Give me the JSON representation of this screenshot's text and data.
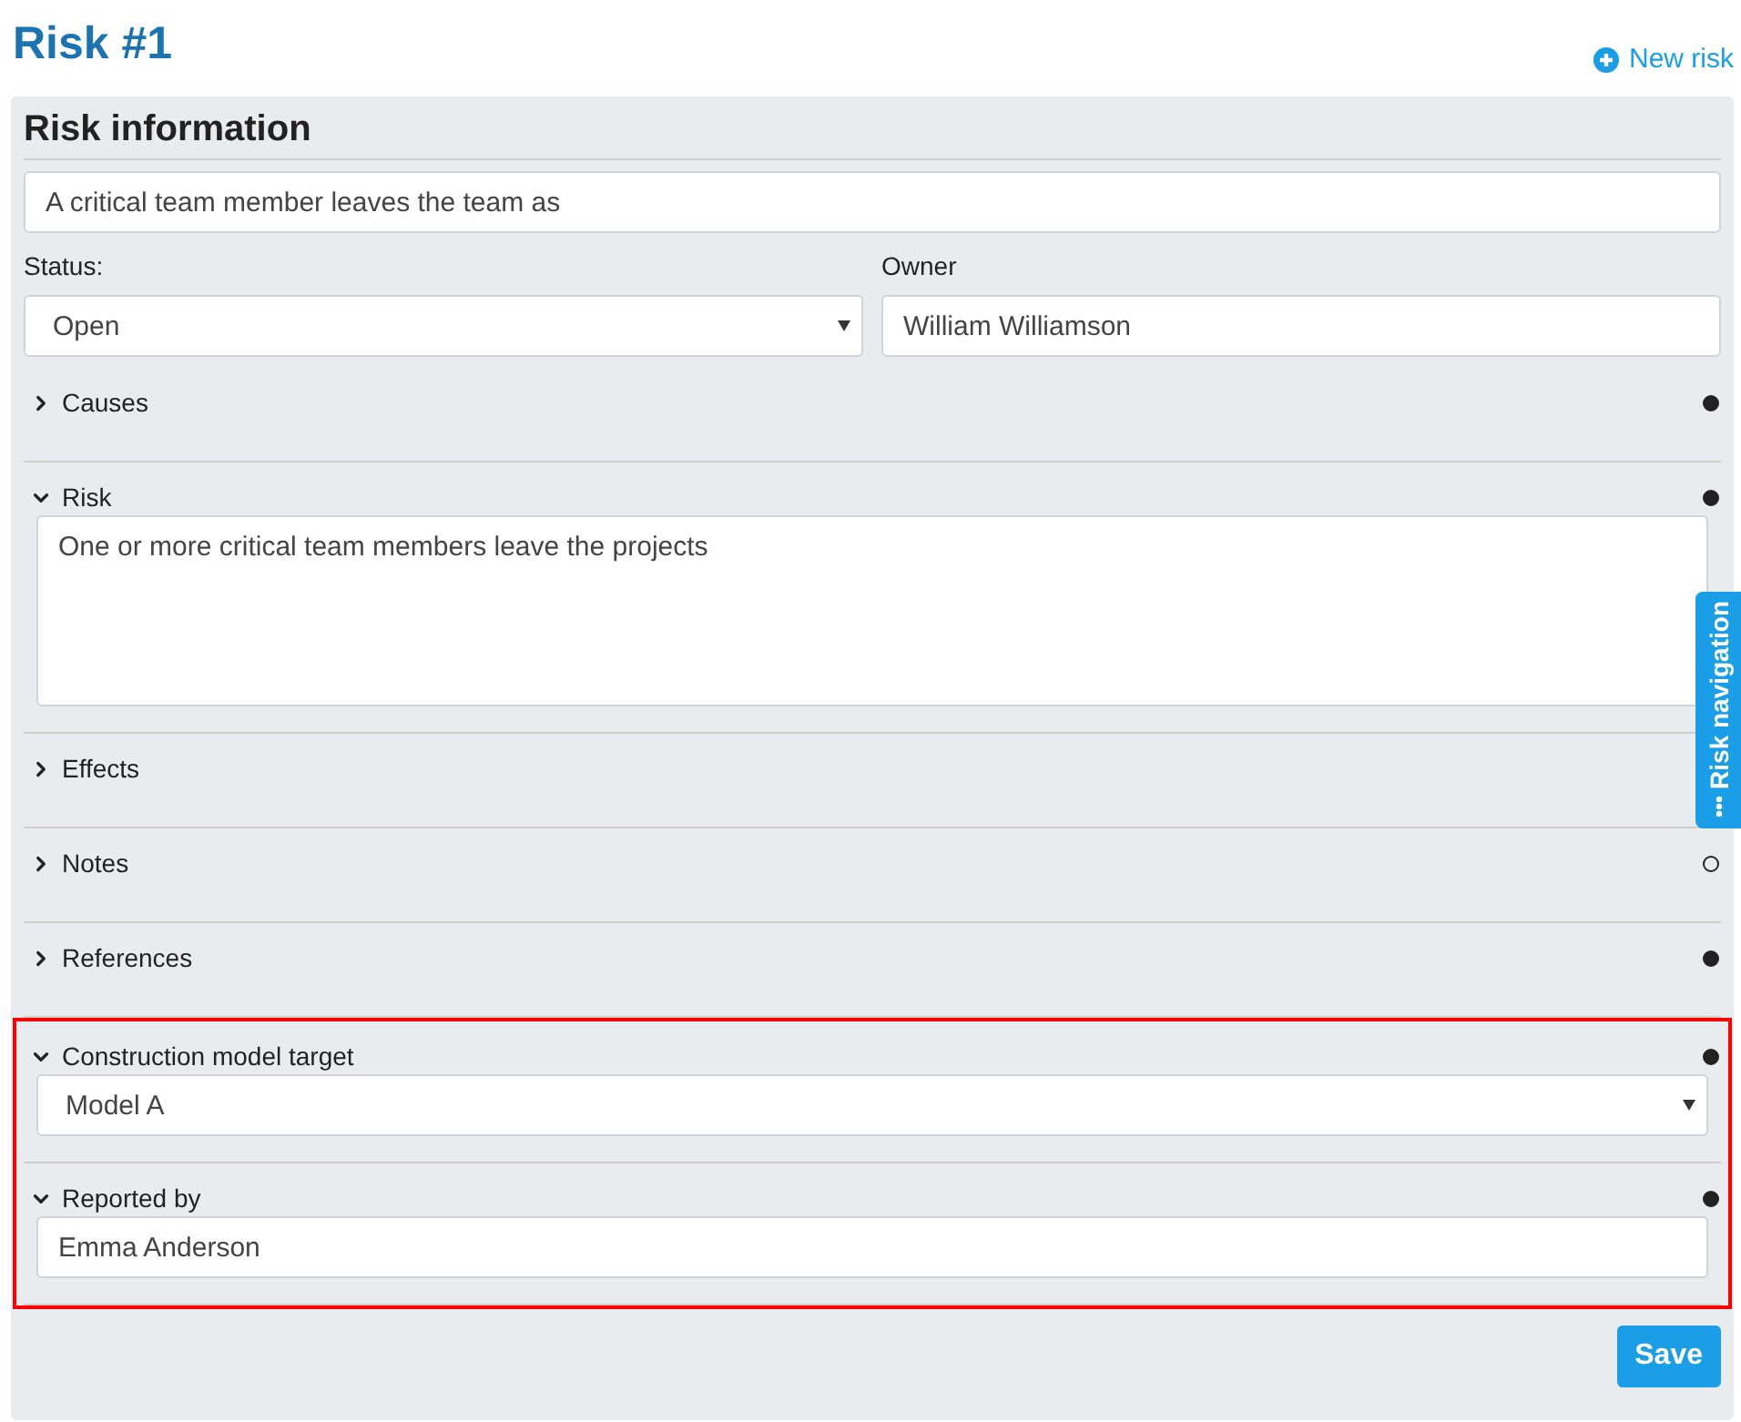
{
  "title": "Risk #1",
  "new_risk_link": "New risk",
  "panel": {
    "heading": "Risk information",
    "name_value": "A critical team member leaves the team as",
    "status": {
      "label": "Status:",
      "value": "Open"
    },
    "owner": {
      "label": "Owner",
      "value": "William Williamson"
    }
  },
  "sections": [
    {
      "label": "Causes",
      "expanded": false,
      "filled": true,
      "highlighted": false
    },
    {
      "label": "Risk",
      "expanded": true,
      "filled": true,
      "highlighted": false,
      "kind": "textarea",
      "value": "One or more critical team members leave the projects"
    },
    {
      "label": "Effects",
      "expanded": false,
      "highlighted": false
    },
    {
      "label": "Notes",
      "expanded": false,
      "filled": false,
      "highlighted": false
    },
    {
      "label": "References",
      "expanded": false,
      "filled": true,
      "highlighted": false
    },
    {
      "label": "Construction model target",
      "expanded": true,
      "filled": true,
      "highlighted": true,
      "kind": "select",
      "value": "Model A"
    },
    {
      "label": "Reported by",
      "expanded": true,
      "filled": true,
      "highlighted": true,
      "kind": "input",
      "value": "Emma Anderson"
    }
  ],
  "save_button": "Save",
  "side_tab": "Risk navigation"
}
